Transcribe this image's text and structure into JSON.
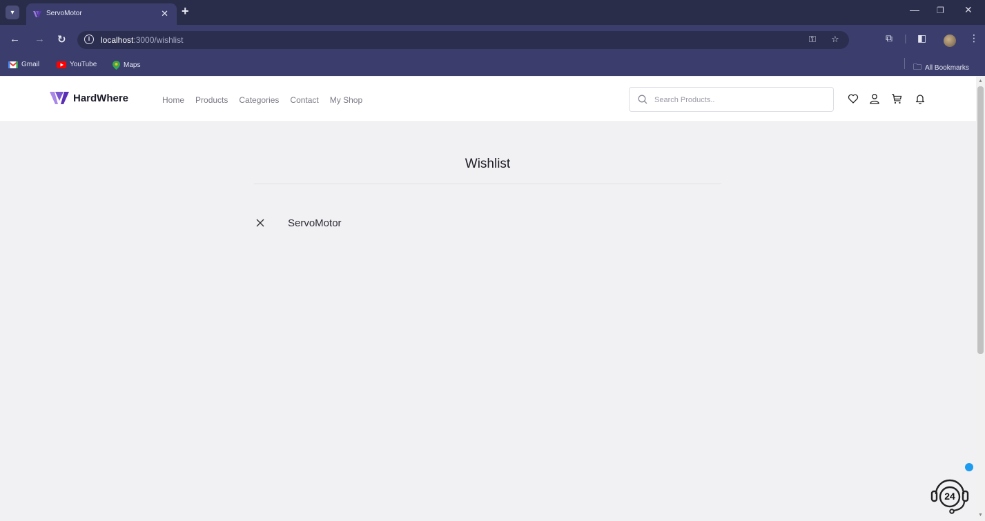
{
  "browser": {
    "tab_title": "ServoMotor",
    "url_host": "localhost",
    "url_path": ":3000/wishlist",
    "bookmarks": [
      {
        "label": "Gmail",
        "icon": "gmail-icon"
      },
      {
        "label": "YouTube",
        "icon": "youtube-icon"
      },
      {
        "label": "Maps",
        "icon": "maps-icon"
      }
    ],
    "all_bookmarks_label": "All Bookmarks"
  },
  "site": {
    "brand": "HardWhere",
    "nav": [
      "Home",
      "Products",
      "Categories",
      "Contact",
      "My Shop"
    ],
    "search_placeholder": "Search Products..",
    "header_icons": [
      "heart-icon",
      "user-icon",
      "cart-icon",
      "bell-icon"
    ]
  },
  "wishlist": {
    "title": "Wishlist",
    "items": [
      {
        "name": "ServoMotor"
      }
    ]
  },
  "support": {
    "badge_text": "24"
  },
  "colors": {
    "browser_frame": "#3b3e6d",
    "tabstrip": "#2a2d4a",
    "logo_purple": "#6c3fc4",
    "page_bg": "#f1f1f4",
    "support_dot": "#1d9bf0"
  }
}
